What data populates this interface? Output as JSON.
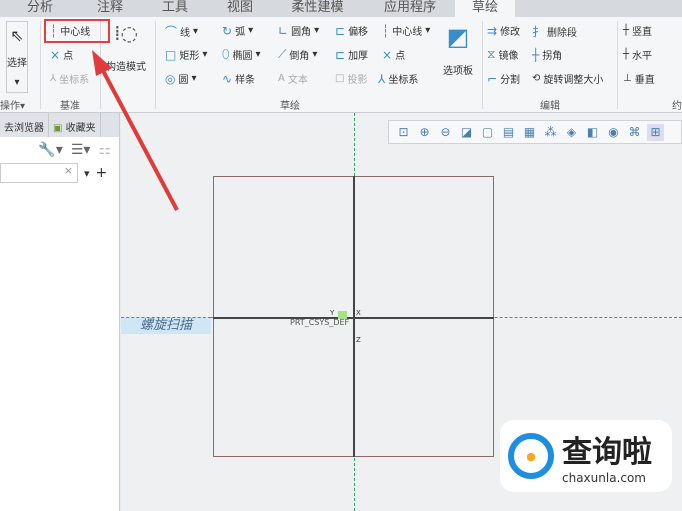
{
  "tabs": [
    "分析",
    "注释",
    "工具",
    "视图",
    "柔性建模",
    "应用程序",
    "螺旋扫描",
    "草绘"
  ],
  "ribbon": {
    "select": "选择",
    "operations": "操作▾",
    "datum": {
      "centerline": "中心线",
      "point": "点",
      "csys": "坐标系",
      "label": "基准"
    },
    "construction": "构造模式",
    "sketch": {
      "line": "线",
      "arc": "弧",
      "fillet": "圆角",
      "offset": "偏移",
      "centerline": "中心线",
      "rect": "矩形",
      "ellipse": "椭圆",
      "chamfer": "倒角",
      "thicken": "加厚",
      "point": "点",
      "circle": "圆",
      "spline": "样条",
      "text": "文本",
      "project": "投影",
      "csys": "坐标系",
      "palette": "选项板",
      "label": "草绘"
    },
    "edit": {
      "modify": "修改",
      "delete_seg": "删除段",
      "mirror": "镜像",
      "corner": "拐角",
      "divide": "分割",
      "rotate_resize": "旋转调整大小",
      "label": "编辑"
    },
    "constrain": {
      "vertical": "竖直",
      "horizontal": "水平",
      "perpendicular": "垂直",
      "label": "约"
    }
  },
  "panel": {
    "tabs": [
      "去浏览器",
      "收藏夹"
    ]
  },
  "canvas": {
    "csys_label": "PRT_CSYS_DEF",
    "axis_x": "X",
    "axis_y": "Y",
    "axis_z": "Z"
  },
  "watermark": {
    "name": "查询啦",
    "url": "chaxunla.com"
  }
}
